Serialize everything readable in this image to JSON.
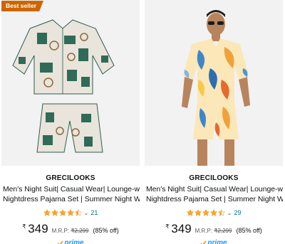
{
  "products": [
    {
      "badge": "Best seller",
      "brand": "GRECILOOKS",
      "title_line1": "Men's Night Suit| Casual Wear| Lounge-wear",
      "title_line2": "Nightdress Pajama Set | Summer Night Wear ..",
      "rating_stars": 4.5,
      "reviews": "21",
      "currency": "₹",
      "price": "349",
      "mrp_label": "M.R.P:",
      "mrp_value": "₹2,299",
      "discount": "(85% off)",
      "prime": "prime"
    },
    {
      "badge": "",
      "brand": "GRECILOOKS",
      "title_line1": "Men's Night Suit| Casual Wear| Lounge-wear",
      "title_line2": "Nightdress Pajama Set | Summer Night Wear ..",
      "rating_stars": 4.5,
      "reviews": "29",
      "currency": "₹",
      "price": "349",
      "mrp_label": "M.R.P:",
      "mrp_value": "₹2,299",
      "discount": "(85% off)",
      "prime": "prime"
    }
  ],
  "colors": {
    "badge": "#cc6600",
    "star": "#ffa41c",
    "link": "#007185",
    "prime": "#1399ff"
  }
}
